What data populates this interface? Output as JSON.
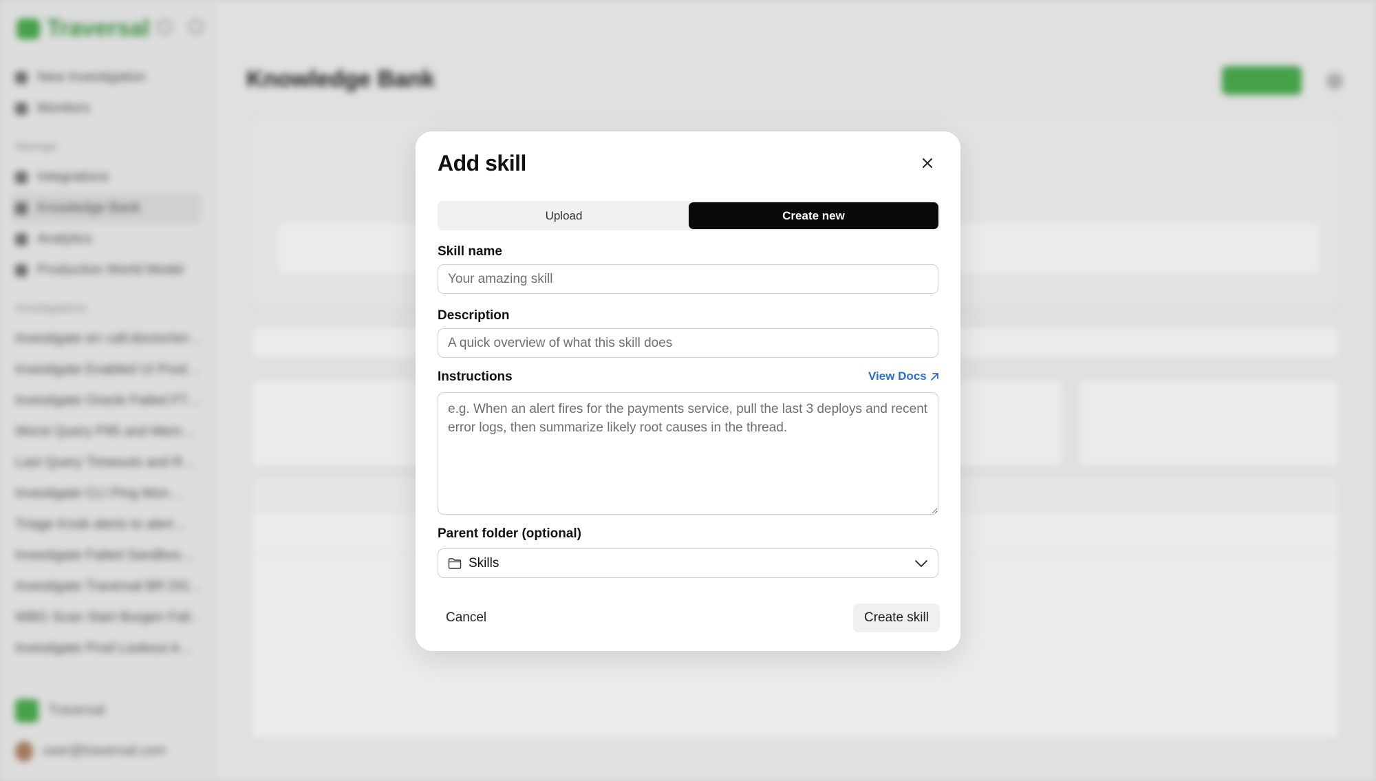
{
  "background": {
    "brand": "Traversal",
    "brand_color": "#4caf50",
    "nav": [
      "New Investigation",
      "Monitors",
      "Integrations",
      "Knowledge Bank",
      "Analytics",
      "Production World Model"
    ],
    "section_manage": "Manage",
    "section_investigations": "Investigations",
    "threads": [
      "Investigate err call:doctor/err…",
      "Investigate Enabled UI Prod…",
      "Investigate Oracle Failed FT…",
      "Worst Query P95 and Mem…",
      "Last Query Timeouts and R…",
      "Investigate CLI Ping Mon…",
      "Triage Knob alerts to alert…",
      "Investigate Failed Sandbox…",
      "Investigate Traversal BR DG…",
      "WBG Scan Start Burgen Fail…",
      "Investigate Prod Lookout A…"
    ],
    "workspace": "Traversal",
    "user_email": "user@traversal.com",
    "page_title": "Knowledge Bank"
  },
  "modal": {
    "title": "Add skill",
    "tabs": [
      {
        "label": "Upload",
        "active": false
      },
      {
        "label": "Create new",
        "active": true
      }
    ],
    "skill_name": {
      "label": "Skill name",
      "value": "",
      "placeholder": "Your amazing skill"
    },
    "description": {
      "label": "Description",
      "value": "",
      "placeholder": "A quick overview of what this skill does"
    },
    "instructions": {
      "label": "Instructions",
      "docs_link": "View Docs",
      "value": "",
      "placeholder": "e.g. When an alert fires for the payments service, pull the last 3 deploys and recent error logs, then summarize likely root causes in the thread."
    },
    "parent_folder": {
      "label": "Parent folder (optional)",
      "selected": "Skills",
      "icon": "folder-icon"
    },
    "cancel_label": "Cancel",
    "create_label": "Create skill",
    "accent_link_color": "#2a6fc9"
  }
}
